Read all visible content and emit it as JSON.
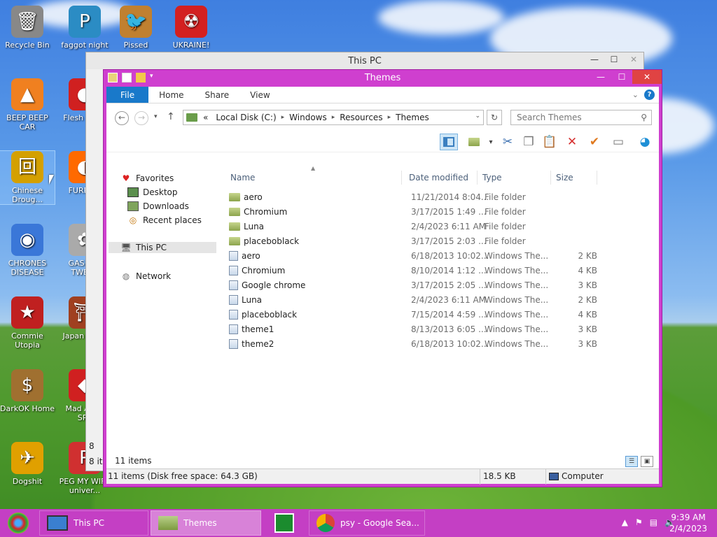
{
  "desktop": {
    "icons": [
      {
        "label": "Recycle Bin",
        "glyph": "🗑"
      },
      {
        "label": "faggot night",
        "glyph": "P"
      },
      {
        "label": "Pissed",
        "glyph": "🐦"
      },
      {
        "label": "UKRAINE!",
        "glyph": "☢"
      },
      {
        "label": "BEEP BEEP CAR",
        "glyph": "▲"
      },
      {
        "label": "Flesh DELU",
        "glyph": "●"
      },
      {
        "label": "Chinese Droug...",
        "glyph": "回"
      },
      {
        "label": "FURRY C",
        "glyph": "◐"
      },
      {
        "label": "CHRONES DISEASE",
        "glyph": "◉"
      },
      {
        "label": "GAS STA TWEAK",
        "glyph": "✿"
      },
      {
        "label": "Commie Utopia",
        "glyph": "★"
      },
      {
        "label": "Japan Loli P",
        "glyph": "⛩"
      },
      {
        "label": "DarkOK Home",
        "glyph": "$"
      },
      {
        "label": "Mad Av IN SPA",
        "glyph": "◆"
      },
      {
        "label": "Dogshit",
        "glyph": "✈"
      },
      {
        "label": "PEG MY WIFE univer...",
        "glyph": "P"
      }
    ]
  },
  "bg_window": {
    "title": "This PC",
    "status_left": "8 it",
    "side_number": "8"
  },
  "window": {
    "title": "Themes",
    "tabs": [
      "File",
      "Home",
      "Share",
      "View"
    ],
    "address": {
      "prefix": "«",
      "segments": [
        "Local Disk (C:)",
        "Windows",
        "Resources",
        "Themes"
      ]
    },
    "search_placeholder": "Search Themes",
    "nav": {
      "favorites": "Favorites",
      "desktop": "Desktop",
      "downloads": "Downloads",
      "recent": "Recent places",
      "thispc": "This PC",
      "network": "Network"
    },
    "columns": {
      "name": "Name",
      "date": "Date modified",
      "type": "Type",
      "size": "Size"
    },
    "files": [
      {
        "name": "aero",
        "date": "11/21/2014 8:04...",
        "type": "File folder",
        "size": "",
        "kind": "folder"
      },
      {
        "name": "Chromium",
        "date": "3/17/2015 1:49 ...",
        "type": "File folder",
        "size": "",
        "kind": "folder"
      },
      {
        "name": "Luna",
        "date": "2/4/2023 6:11 AM",
        "type": "File folder",
        "size": "",
        "kind": "folder"
      },
      {
        "name": "placeboblack",
        "date": "3/17/2015 2:03 ...",
        "type": "File folder",
        "size": "",
        "kind": "folder"
      },
      {
        "name": "aero",
        "date": "6/18/2013 10:02...",
        "type": "Windows The...",
        "size": "2 KB",
        "kind": "theme"
      },
      {
        "name": "Chromium",
        "date": "8/10/2014 1:12 ...",
        "type": "Windows The...",
        "size": "4 KB",
        "kind": "theme"
      },
      {
        "name": "Google chrome",
        "date": "3/17/2015 2:05 ...",
        "type": "Windows The...",
        "size": "3 KB",
        "kind": "theme"
      },
      {
        "name": "Luna",
        "date": "2/4/2023 6:11 AM",
        "type": "Windows The...",
        "size": "2 KB",
        "kind": "theme"
      },
      {
        "name": "placeboblack",
        "date": "7/15/2014 4:59 ...",
        "type": "Windows The...",
        "size": "4 KB",
        "kind": "theme"
      },
      {
        "name": "theme1",
        "date": "8/13/2013 6:05 ...",
        "type": "Windows The...",
        "size": "3 KB",
        "kind": "theme"
      },
      {
        "name": "theme2",
        "date": "6/18/2013 10:02...",
        "type": "Windows The...",
        "size": "3 KB",
        "kind": "theme"
      }
    ],
    "item_count": "11 items",
    "status": {
      "left": "11 items (Disk free space: 64.3 GB)",
      "middle": "18.5 KB",
      "right": "Computer"
    }
  },
  "taskbar": {
    "buttons": [
      {
        "label": "This PC"
      },
      {
        "label": "Themes"
      },
      {
        "label": "psy - Google Sea..."
      }
    ],
    "time": "9:39 AM",
    "date": "2/4/2023"
  },
  "colors": {
    "accent": "#cf3fcf",
    "file_tab": "#1979ca",
    "close": "#e04343"
  }
}
